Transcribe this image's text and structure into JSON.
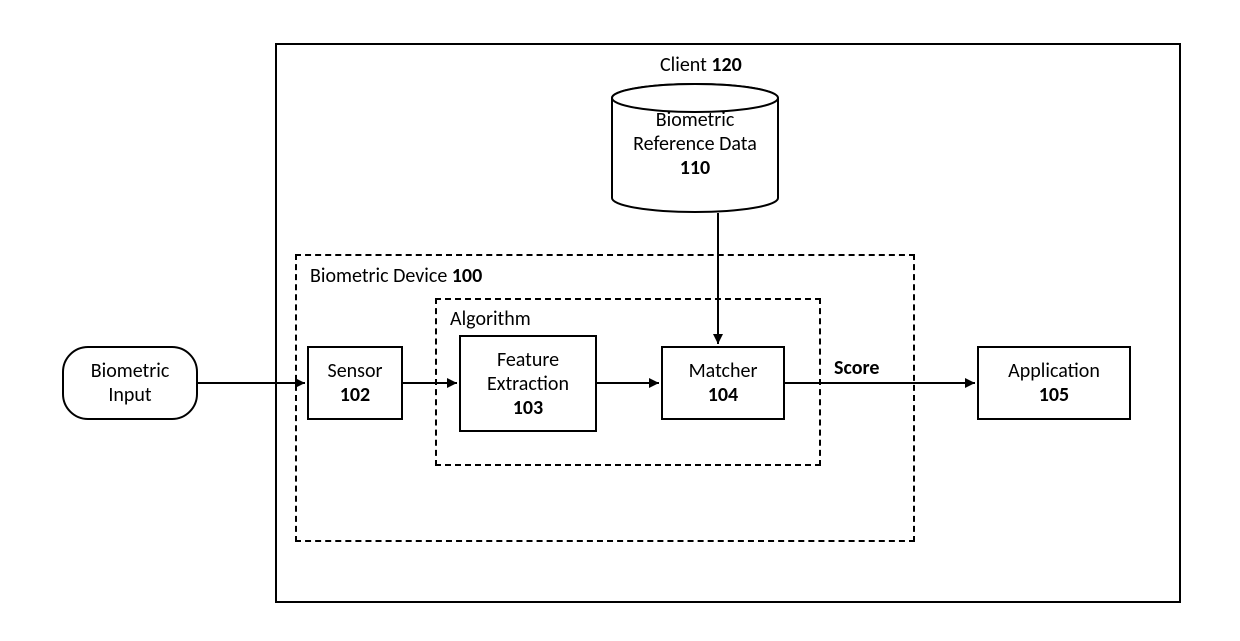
{
  "diagram": {
    "client": {
      "title": "Client",
      "ref": "120"
    },
    "reference_data": {
      "line1": "Biometric",
      "line2": "Reference Data",
      "ref": "110"
    },
    "device": {
      "title": "Biometric Device",
      "ref": "100"
    },
    "algorithm": {
      "title": "Algorithm"
    },
    "input": {
      "line1": "Biometric",
      "line2": "Input"
    },
    "sensor": {
      "title": "Sensor",
      "ref": "102"
    },
    "feature_extraction": {
      "line1": "Feature",
      "line2": "Extraction",
      "ref": "103"
    },
    "matcher": {
      "title": "Matcher",
      "ref": "104"
    },
    "score_label": "Score",
    "application": {
      "title": "Application",
      "ref": "105"
    }
  }
}
